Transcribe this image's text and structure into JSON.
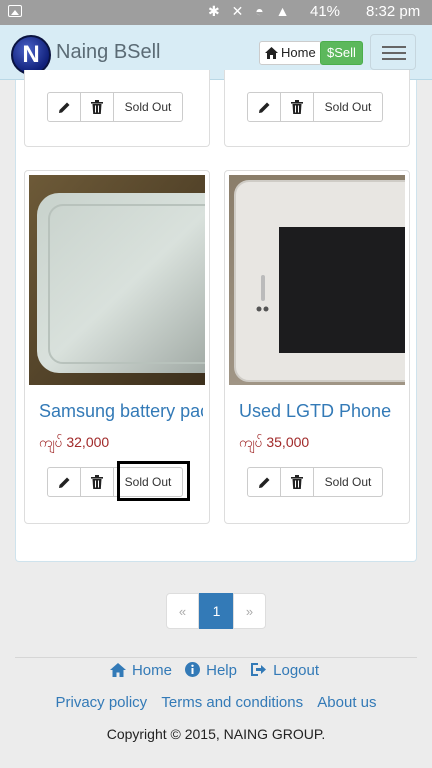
{
  "status_bar": {
    "battery": "41%",
    "time": "8:32 pm",
    "icons": "✱ ✕ ◓ ▲"
  },
  "navbar": {
    "logo_letter": "N",
    "brand": "Naing BSell",
    "home_label": "Home",
    "sell_label": "$Sell"
  },
  "products_top": [
    {
      "sold_label": "Sold Out"
    },
    {
      "sold_label": "Sold Out"
    }
  ],
  "products": [
    {
      "title": "Samsung battery pack",
      "price": "ကျပ် 32,000",
      "sold_label": "Sold Out"
    },
    {
      "title": "Used LGTD Phone",
      "price": "ကျပ် 35,000",
      "sold_label": "Sold Out"
    }
  ],
  "pagination": {
    "prev": "«",
    "current": "1",
    "next": "»"
  },
  "footer": {
    "home": "Home",
    "help": "Help",
    "logout": "Logout",
    "privacy": "Privacy policy",
    "terms": "Terms and conditions",
    "about": "About us",
    "copyright": "Copyright © 2015, NAING GROUP."
  },
  "colors": {
    "link": "#337ab7",
    "price": "#a12a2a",
    "sell": "#5cb85c",
    "navbar_bg": "#d8ecf5"
  }
}
